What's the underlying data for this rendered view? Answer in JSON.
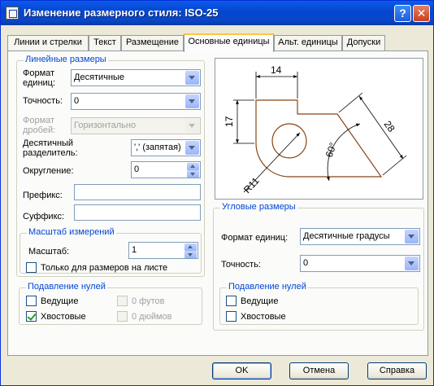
{
  "window": {
    "title": "Изменение размерного стиля: ISO-25"
  },
  "titlebar_buttons": {
    "help": "?",
    "close": "✕"
  },
  "tabs": [
    {
      "label": "Линии и стрелки",
      "active": false
    },
    {
      "label": "Текст",
      "active": false
    },
    {
      "label": "Размещение",
      "active": false
    },
    {
      "label": "Основные единицы",
      "active": true
    },
    {
      "label": "Альт. единицы",
      "active": false
    },
    {
      "label": "Допуски",
      "active": false
    }
  ],
  "linear": {
    "legend": "Линейные размеры",
    "unit_format": {
      "label_line1": "Формат",
      "label_line2": "единиц:",
      "value": "Десятичные"
    },
    "precision": {
      "label": "Точность:",
      "value": "0"
    },
    "fraction_format": {
      "label_line1": "Формат",
      "label_line2": "дробей:",
      "value": "Горизонтально"
    },
    "decimal_separator": {
      "label_line1": "Десятичный",
      "label_line2": "разделитель:",
      "value": "',' (запятая)"
    },
    "round_off": {
      "label": "Округление:",
      "value": "0"
    },
    "prefix": {
      "label": "Префикс:",
      "value": ""
    },
    "suffix": {
      "label": "Суффикс:",
      "value": ""
    }
  },
  "scale": {
    "legend": "Масштаб измерений",
    "factor": {
      "label": "Масштаб:",
      "value": "1"
    },
    "layout_only": {
      "label": "Только для размеров на листе",
      "checked": false
    }
  },
  "zero_suppression": {
    "legend": "Подавление нулей",
    "leading": {
      "label": "Ведущие",
      "checked": false
    },
    "trailing": {
      "label": "Хвостовые",
      "checked": true
    },
    "feet": {
      "label": "0 футов",
      "checked": false,
      "enabled": false
    },
    "inches": {
      "label": "0 дюймов",
      "checked": false,
      "enabled": false
    }
  },
  "preview": {
    "dim_top": "14",
    "dim_left": "17",
    "dim_diag": "28",
    "dim_angle": "60°",
    "dim_radius": "R11"
  },
  "angular": {
    "legend": "Угловые размеры",
    "unit_format": {
      "label": "Формат единиц:",
      "value": "Десятичные градусы"
    },
    "precision": {
      "label": "Точность:",
      "value": "0"
    },
    "zero_suppression": {
      "legend": "Подавление нулей",
      "leading": {
        "label": "Ведущие",
        "checked": false
      },
      "trailing": {
        "label": "Хвостовые",
        "checked": false
      }
    }
  },
  "buttons": {
    "ok": "OK",
    "cancel": "Отмена",
    "help": "Справка"
  },
  "colors": {
    "title_bar": "#0a5be8",
    "legend_text": "#0046d5",
    "active_tab_accent": "#ffc83c",
    "preview_outline": "#8b4513"
  }
}
